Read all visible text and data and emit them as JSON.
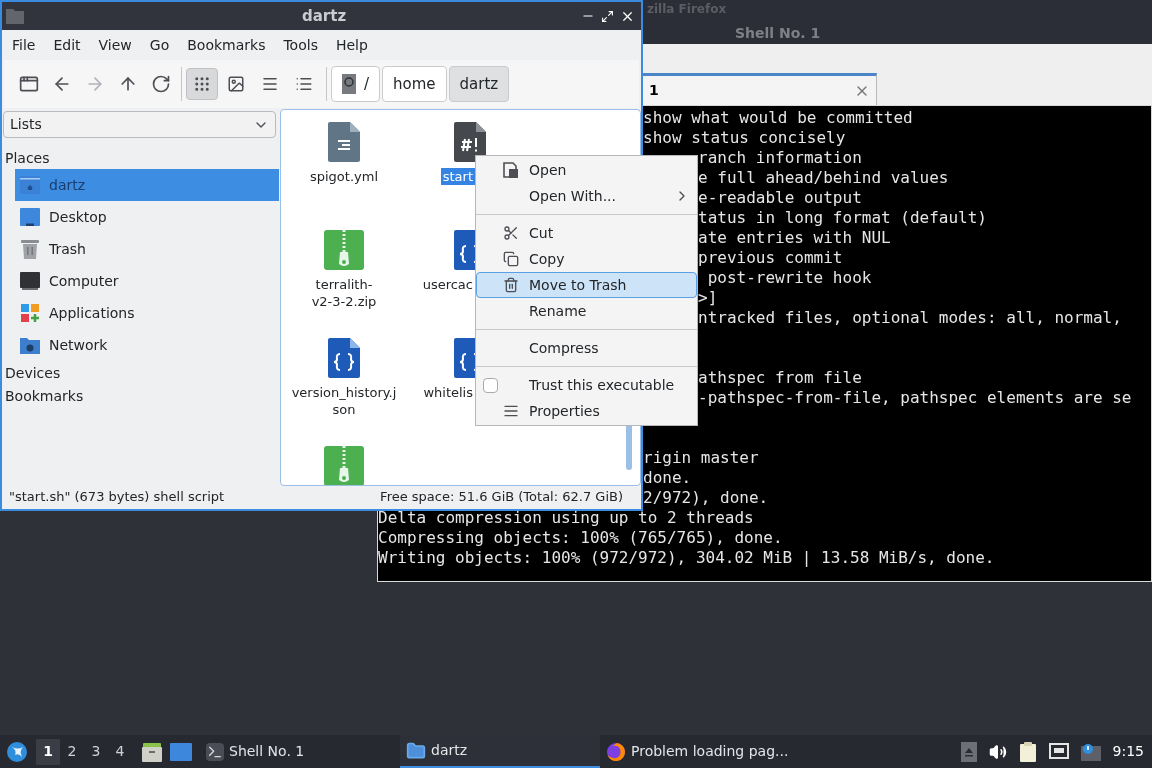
{
  "background_window": {
    "title": "zilla Firefox"
  },
  "terminal_window": {
    "title": "Shell No. 1",
    "tab": {
      "label": "1",
      "selected": true
    },
    "lines": [
      {
        "kind": "behind_window",
        "text": "show what would be committed"
      },
      {
        "kind": "behind_window",
        "text": "show status concisely"
      },
      {
        "kind": "behind_menu",
        "text": "ranch information"
      },
      {
        "kind": "behind_menu",
        "text": "e full ahead/behind values"
      },
      {
        "kind": "behind_menu",
        "text": "e-readable output"
      },
      {
        "kind": "behind_menu",
        "text": "tatus in long format (default)"
      },
      {
        "kind": "behind_menu",
        "text": "ate entries with NUL"
      },
      {
        "kind": "behind_menu",
        "text": "previous commit"
      },
      {
        "kind": "behind_menu",
        "text": " post-rewrite hook"
      },
      {
        "kind": "behind_menu",
        "text": ">]"
      },
      {
        "kind": "behind_menu",
        "text": "ntracked files, optional modes: all, normal,"
      },
      {
        "kind": "blank"
      },
      {
        "kind": "blank"
      },
      {
        "kind": "behind_menu",
        "text": "athspec from file"
      },
      {
        "kind": "behind_menu",
        "text": "-pathspec-from-file, pathspec elements are se"
      },
      {
        "kind": "blank"
      },
      {
        "kind": "blank"
      },
      {
        "kind": "behind_window",
        "text": "rigin master"
      },
      {
        "kind": "behind_window",
        "text": "done."
      },
      {
        "kind": "behind_window",
        "text": "2/972), done."
      },
      {
        "kind": "full",
        "text": "Delta compression using up to 2 threads"
      },
      {
        "kind": "full",
        "text": "Compressing objects: 100% (765/765), done."
      },
      {
        "kind": "full",
        "text": "Writing objects: 100% (972/972), 304.02 MiB | 13.58 MiB/s, done."
      }
    ]
  },
  "file_manager": {
    "title": "dartz",
    "menu": [
      "File",
      "Edit",
      "View",
      "Go",
      "Bookmarks",
      "Tools",
      "Help"
    ],
    "nav": [
      {
        "kind": "new_tab",
        "disabled": false
      },
      {
        "kind": "back",
        "disabled": false
      },
      {
        "kind": "forward",
        "disabled": true
      },
      {
        "kind": "up",
        "disabled": false
      },
      {
        "kind": "reload",
        "disabled": false
      }
    ],
    "view_modes": [
      {
        "kind": "icons",
        "selected": true
      },
      {
        "kind": "thumbnails",
        "selected": false
      },
      {
        "kind": "compact",
        "selected": false
      },
      {
        "kind": "details",
        "selected": false
      }
    ],
    "path": [
      {
        "kind": "root",
        "label": "/",
        "selected": false
      },
      {
        "kind": "dir",
        "label": "home",
        "selected": false
      },
      {
        "kind": "dir",
        "label": "dartz",
        "selected": true
      }
    ],
    "side_dropdown": "Lists",
    "sections": [
      {
        "title": "Places",
        "items": [
          {
            "kind": "home",
            "label": "dartz",
            "selected": true
          },
          {
            "kind": "desktop",
            "label": "Desktop",
            "selected": false
          },
          {
            "kind": "trash",
            "label": "Trash",
            "selected": false
          },
          {
            "kind": "computer",
            "label": "Computer",
            "selected": false
          },
          {
            "kind": "apps",
            "label": "Applications",
            "selected": false
          },
          {
            "kind": "network",
            "label": "Network",
            "selected": false
          }
        ]
      },
      {
        "title": "Devices"
      },
      {
        "title": "Bookmarks"
      }
    ],
    "files": [
      {
        "kind": "text",
        "name_lines": [
          "spigot.yml"
        ],
        "selected": false
      },
      {
        "kind": "script",
        "name_lines": [
          "start"
        ],
        "selected": true
      },
      {
        "kind": "zip",
        "name_lines": [
          "terralith-",
          "v2-3-2.zip"
        ],
        "selected": false
      },
      {
        "kind": "json",
        "name_lines": [
          "usercac"
        ],
        "selected": false
      },
      {
        "kind": "json",
        "name_lines": [
          "version_history.j",
          "son"
        ],
        "selected": false
      },
      {
        "kind": "json",
        "name_lines": [
          "whitelis"
        ],
        "selected": false
      },
      {
        "kind": "zip"
      }
    ],
    "status": "\"start.sh\" (673 bytes) shell script",
    "free_space": "Free space: 51.6 GiB (Total: 62.7 GiB)"
  },
  "context_menu": [
    {
      "kind": "open",
      "label": "Open",
      "selected": false
    },
    {
      "kind": "submenu",
      "label": "Open With...",
      "selected": false
    },
    {
      "kind": "separator"
    },
    {
      "kind": "cut",
      "label": "Cut",
      "selected": false
    },
    {
      "kind": "copy",
      "label": "Copy",
      "selected": false
    },
    {
      "kind": "trash",
      "label": "Move to Trash",
      "selected": true
    },
    {
      "kind": "plain",
      "label": "Rename",
      "selected": false
    },
    {
      "kind": "separator"
    },
    {
      "kind": "plain",
      "label": "Compress",
      "selected": false
    },
    {
      "kind": "separator"
    },
    {
      "kind": "check",
      "label": "Trust this executable",
      "checked": false,
      "selected": false
    },
    {
      "kind": "properties",
      "label": "Properties",
      "selected": false
    }
  ],
  "taskbar": {
    "workspaces": [
      {
        "label": "1",
        "selected": true
      },
      {
        "label": "2",
        "selected": false
      },
      {
        "label": "3",
        "selected": false
      },
      {
        "label": "4",
        "selected": false
      }
    ],
    "tasks": [
      {
        "kind": "terminal",
        "label": "Shell No. 1",
        "selected": false
      },
      {
        "kind": "folder",
        "label": "dartz",
        "selected": true
      },
      {
        "kind": "browser",
        "label": "Problem loading pag...",
        "selected": false
      }
    ],
    "clock": "9:15"
  }
}
